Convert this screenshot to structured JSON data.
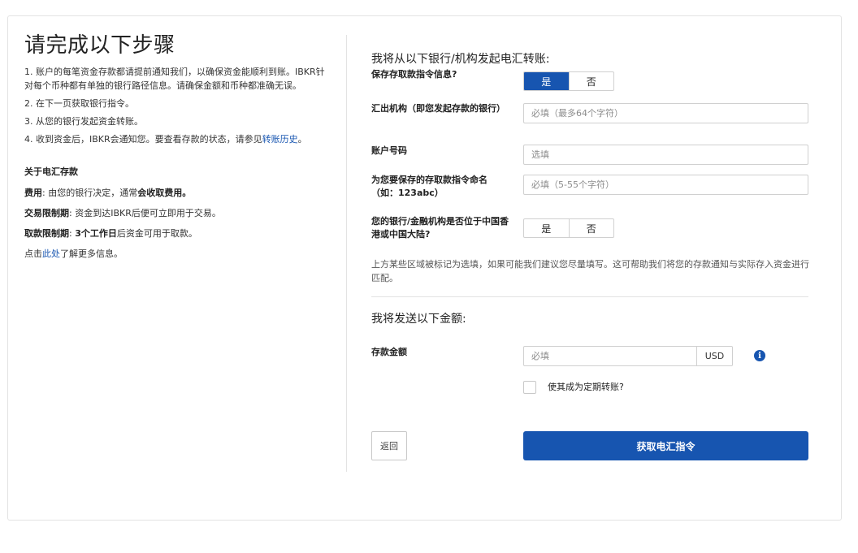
{
  "left": {
    "title": "请完成以下步骤",
    "steps": [
      "1. 账户的每笔资金存款都请提前通知我们，以确保资金能顺利到账。IBKR针对每个币种都有单独的银行路径信息。请确保金额和币种都准确无误。",
      "2. 在下一页获取银行指令。",
      "3. 从您的银行发起资金转账。",
      "4. 收到资金后，IBKR会通知您。要查看存款的状态，请参见"
    ],
    "step4_link": "转账历史",
    "step4_suffix": "。",
    "about": {
      "title": "关于电汇存款",
      "fee_label": "费用",
      "fee_text": ": 由您的银行决定，通常",
      "fee_bold": "会收取费用。",
      "trade_label": "交易限制期",
      "trade_text": ": 资金到达IBKR后便可立即用于交易。",
      "withdraw_label": "取款限制期",
      "withdraw_colon": ": ",
      "withdraw_bold": "3个工作日",
      "withdraw_text": "后资金可用于取款。",
      "more_prefix": "点击",
      "more_link": "此处",
      "more_suffix": "了解更多信息。"
    }
  },
  "form": {
    "section1_title": "我将从以下银行/机构发起电汇转账:",
    "save_label": "保存存取款指令信息?",
    "save_options": [
      "是",
      "否"
    ],
    "save_selected": "是",
    "institution_label": "汇出机构（即您发起存款的银行）",
    "institution_placeholder": "必填（最多64个字符）",
    "account_label": "账户号码",
    "account_placeholder": "选填",
    "name_label": "为您要保存的存取款指令命名（如：123abc）",
    "name_placeholder": "必填（5-55个字符）",
    "location_label": "您的银行/金融机构是否位于中国香港或中国大陆?",
    "location_options": [
      "是",
      "否"
    ],
    "note": "上方某些区域被标记为选填，如果可能我们建议您尽量填写。这可帮助我们将您的存款通知与实际存入资金进行匹配。",
    "section2_title": "我将发送以下金额:",
    "amount_label": "存款金额",
    "amount_placeholder": "必填",
    "currency": "USD",
    "info_icon": "i",
    "recurring_label": "使其成为定期转账?",
    "back_label": "返回",
    "submit_label": "获取电汇指令"
  },
  "colors": {
    "accent": "#1755b0",
    "border": "#d0d0d0",
    "divider": "#e3e3e3"
  },
  "icons": {
    "info": "info-icon",
    "checkbox": "checkbox-icon"
  }
}
